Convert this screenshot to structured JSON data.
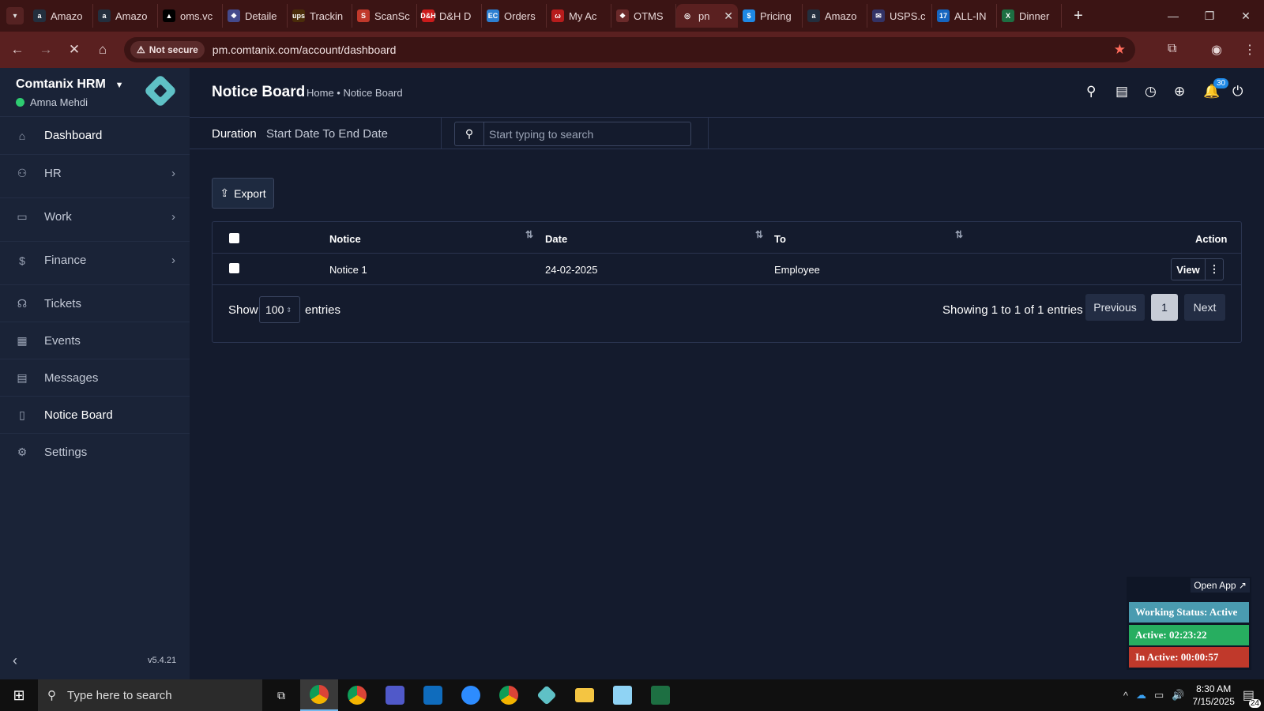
{
  "browser": {
    "tabs": [
      {
        "title": "Amazo",
        "favicon": "amazon-icon",
        "color": "#232f3e"
      },
      {
        "title": "Amazo",
        "favicon": "amazon-icon",
        "color": "#232f3e"
      },
      {
        "title": "oms.vc",
        "favicon": "oms-icon",
        "color": "#000000"
      },
      {
        "title": "Detaile",
        "favicon": "detail-icon",
        "color": "#444a8c"
      },
      {
        "title": "Trackin",
        "favicon": "ups-icon",
        "color": "#4a2d0a"
      },
      {
        "title": "ScanSc",
        "favicon": "scan-icon",
        "color": "#c0392b"
      },
      {
        "title": "D&H D",
        "favicon": "dh-icon",
        "color": "#cc1b1b"
      },
      {
        "title": "Orders",
        "favicon": "ec-icon",
        "color": "#2d7fd1"
      },
      {
        "title": "My Ac",
        "favicon": "account-icon",
        "color": "#b71c1c"
      },
      {
        "title": "OTMS",
        "favicon": "otms-icon",
        "color": "#6b2a2a"
      },
      {
        "title": "pn",
        "favicon": "pm-icon",
        "color": "#5a2020",
        "active": true
      },
      {
        "title": "Pricing",
        "favicon": "dollar-icon",
        "color": "#1e88e5"
      },
      {
        "title": "Amazo",
        "favicon": "amazon-icon",
        "color": "#232f3e"
      },
      {
        "title": "USPS.c",
        "favicon": "usps-icon",
        "color": "#333366"
      },
      {
        "title": "ALL-IN",
        "favicon": "allin-icon",
        "color": "#1565c0"
      },
      {
        "title": "Dinner",
        "favicon": "excel-icon",
        "color": "#1d6f42"
      }
    ],
    "tab_favicon_letters": [
      "a",
      "a",
      "▲",
      "❖",
      "ups",
      "S",
      "D&H",
      "EC",
      "ω",
      "❖",
      "◎",
      "$",
      "a",
      "✉",
      "17",
      "X"
    ],
    "security_label": "Not secure",
    "url": "pm.comtanix.com/account/dashboard"
  },
  "sidebar": {
    "brand": "Comtanix HRM",
    "user": "Amna Mehdi",
    "items": [
      {
        "label": "Dashboard",
        "icon": "home-icon"
      },
      {
        "label": "HR",
        "icon": "users-icon"
      },
      {
        "label": "Work",
        "icon": "briefcase-icon"
      },
      {
        "label": "Finance",
        "icon": "dollar-icon"
      },
      {
        "label": "Tickets",
        "icon": "headset-icon"
      },
      {
        "label": "Events",
        "icon": "calendar-icon"
      },
      {
        "label": "Messages",
        "icon": "message-icon"
      },
      {
        "label": "Notice Board",
        "icon": "clipboard-icon"
      },
      {
        "label": "Settings",
        "icon": "gear-icon"
      }
    ],
    "version": "v5.4.21"
  },
  "header": {
    "title": "Notice Board",
    "breadcrumb": "Home • Notice Board",
    "notification_count": "30"
  },
  "filters": {
    "duration_label": "Duration",
    "duration_value": "Start Date To End Date",
    "search_placeholder": "Start typing to search"
  },
  "toolbar": {
    "export_label": "Export"
  },
  "table": {
    "columns": [
      "Notice",
      "Date",
      "To",
      "Action"
    ],
    "rows": [
      {
        "notice": "Notice 1",
        "date": "24-02-2025",
        "to": "Employee",
        "action": "View"
      }
    ],
    "show_label": "Show",
    "page_size": "100",
    "entries_label": "entries",
    "info": "Showing 1 to 1 of 1 entries",
    "previous": "Previous",
    "current_page": "1",
    "next": "Next"
  },
  "widget": {
    "open_app": "Open App ↗",
    "working_status": "Working Status: Active",
    "active": "Active: 02:23:22",
    "inactive": "In Active: 00:00:57",
    "colors": {
      "status": "#4a9bb0",
      "active": "#27ae60",
      "inactive": "#c0392b"
    }
  },
  "taskbar": {
    "search_placeholder": "Type here to search",
    "time": "8:30 AM",
    "date": "7/15/2025",
    "notifications": "24"
  }
}
